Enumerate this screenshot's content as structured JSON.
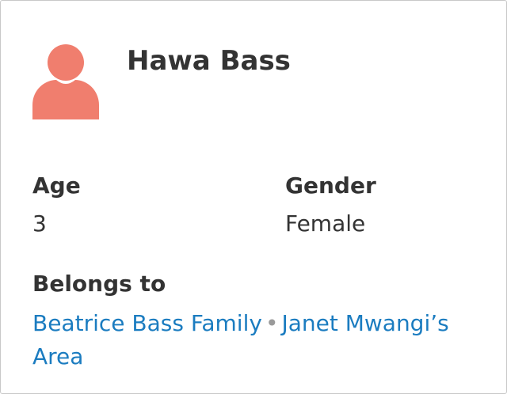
{
  "contact": {
    "name": "Hawa Bass",
    "avatar_icon": "person-icon",
    "avatar_color": "#f07e6e"
  },
  "fields": {
    "age_label": "Age",
    "age_value": "3",
    "gender_label": "Gender",
    "gender_value": "Female",
    "belongs_label": "Belongs to",
    "belongs_family": "Beatrice Bass Family",
    "belongs_separator": "•",
    "belongs_area": "Janet Mwangi’s Area"
  },
  "colors": {
    "link": "#1b7cc0",
    "text": "#333333"
  }
}
